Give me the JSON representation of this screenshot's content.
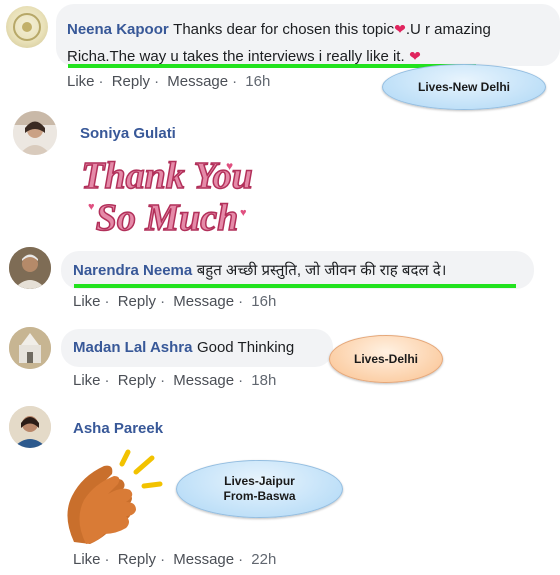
{
  "comments": [
    {
      "name": "Neena Kapoor",
      "text_line1": "Thanks dear for chosen this topic",
      "text_line1_end": ".U r amazing",
      "text_line2": "Richa.The way u takes the interviews i really like it.",
      "heart": "❤",
      "actions": [
        "Like",
        "Reply",
        "Message"
      ],
      "time": "16h",
      "callout": "Lives-New Delhi"
    },
    {
      "name": "Soniya Gulati",
      "sticker": {
        "line1": "Thank You",
        "line2": "So Much"
      }
    },
    {
      "name": "Narendra Neema",
      "text": "बहुत अच्छी प्रस्तुति, जो जीवन की राह बदल दे।",
      "actions": [
        "Like",
        "Reply",
        "Message"
      ],
      "time": "16h"
    },
    {
      "name": "Madan Lal Ashra",
      "text": "Good Thinking",
      "actions": [
        "Like",
        "Reply",
        "Message"
      ],
      "time": "18h",
      "callout": "Lives-Delhi"
    },
    {
      "name": "Asha Pareek",
      "actions": [
        "Like",
        "Reply",
        "Message"
      ],
      "time": "22h",
      "callout_line1": "Lives-Jaipur",
      "callout_line2": "From-Baswa"
    }
  ],
  "colors": {
    "name": "#385898",
    "underline": "#22e21e",
    "action": "#616770"
  }
}
